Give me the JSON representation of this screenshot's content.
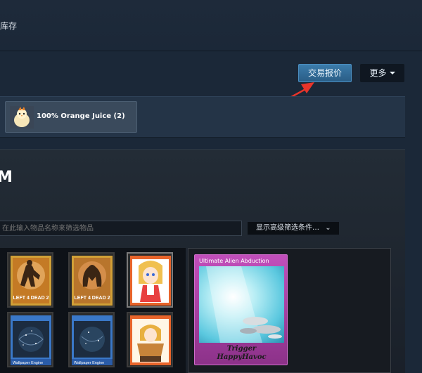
{
  "header": {
    "crumb": "库存"
  },
  "actions": {
    "trade_offer": "交易报价",
    "more": "更多"
  },
  "game_tab": {
    "name": "100% Orange Juice (2)",
    "icon": "chick-game-icon"
  },
  "inventory": {
    "title_fragment": "M"
  },
  "filter": {
    "placeholder": "在此输入物品名称来筛选物品",
    "advanced": "显示高级筛选条件…"
  },
  "items": [
    {
      "type": "left4dead2-card",
      "label": "LEFT 4 DEAD 2"
    },
    {
      "type": "left4dead2-card",
      "label": "LEFT 4 DEAD 2"
    },
    {
      "type": "anime-card"
    },
    {
      "type": "wallpaper-card",
      "label": "Wallpaper Engine"
    },
    {
      "type": "wallpaper-card",
      "label": "Wallpaper Engine"
    },
    {
      "type": "anime-card-2"
    }
  ],
  "selected_card": {
    "title": "Ultimate Alien Abduction",
    "logo_line1": "Trigger",
    "logo_line2": "HappyHavoc"
  },
  "colors": {
    "background": "#1b2838",
    "trade_button": "#2a5d86",
    "arrow": "#e8342a",
    "card_frame": "#c24fbb"
  }
}
